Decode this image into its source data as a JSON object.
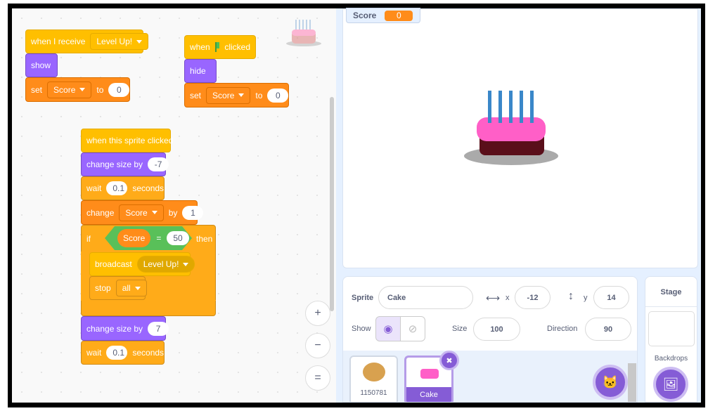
{
  "scripts": {
    "s1": {
      "hat": "when I receive",
      "msg": "Level Up!",
      "show": "show",
      "set": "set",
      "var": "Score",
      "to": "to",
      "val": "0"
    },
    "s2": {
      "when": "when",
      "clicked": "clicked",
      "hide": "hide",
      "set": "set",
      "var": "Score",
      "to": "to",
      "val": "0"
    },
    "s3": {
      "hat": "when this sprite clicked",
      "cs1": "change size by",
      "cs1_val": "-7",
      "wait1": "wait",
      "wait1_val": "0.1",
      "seconds": "seconds",
      "change": "change",
      "change_var": "Score",
      "by": "by",
      "change_val": "1",
      "if": "if",
      "cmp_var": "Score",
      "eq": "=",
      "cmp_val": "50",
      "then": "then",
      "broadcast": "broadcast",
      "broadcast_msg": "Level Up!",
      "stop": "stop",
      "stop_opt": "all",
      "cs2": "change size by",
      "cs2_val": "7",
      "wait2": "wait",
      "wait2_val": "0.1"
    }
  },
  "zoom": {
    "in": "+",
    "out": "−",
    "reset": "="
  },
  "monitor": {
    "label": "Score",
    "value": "0"
  },
  "sprite_info": {
    "sprite_label": "Sprite",
    "sprite_name": "Cake",
    "x_label": "x",
    "x": "-12",
    "y_label": "y",
    "y": "14",
    "show_label": "Show",
    "size_label": "Size",
    "size": "100",
    "direction_label": "Direction",
    "direction": "90"
  },
  "sprites": [
    {
      "name": "1150781"
    },
    {
      "name": "Cake"
    }
  ],
  "stage_panel": {
    "title": "Stage",
    "backdrops": "Backdrops"
  },
  "colors": {
    "events": "#ffbf00",
    "looks": "#9966ff",
    "variables": "#ff8c1a",
    "control": "#ffab19",
    "operators": "#59c059",
    "accent": "#855cd6"
  }
}
